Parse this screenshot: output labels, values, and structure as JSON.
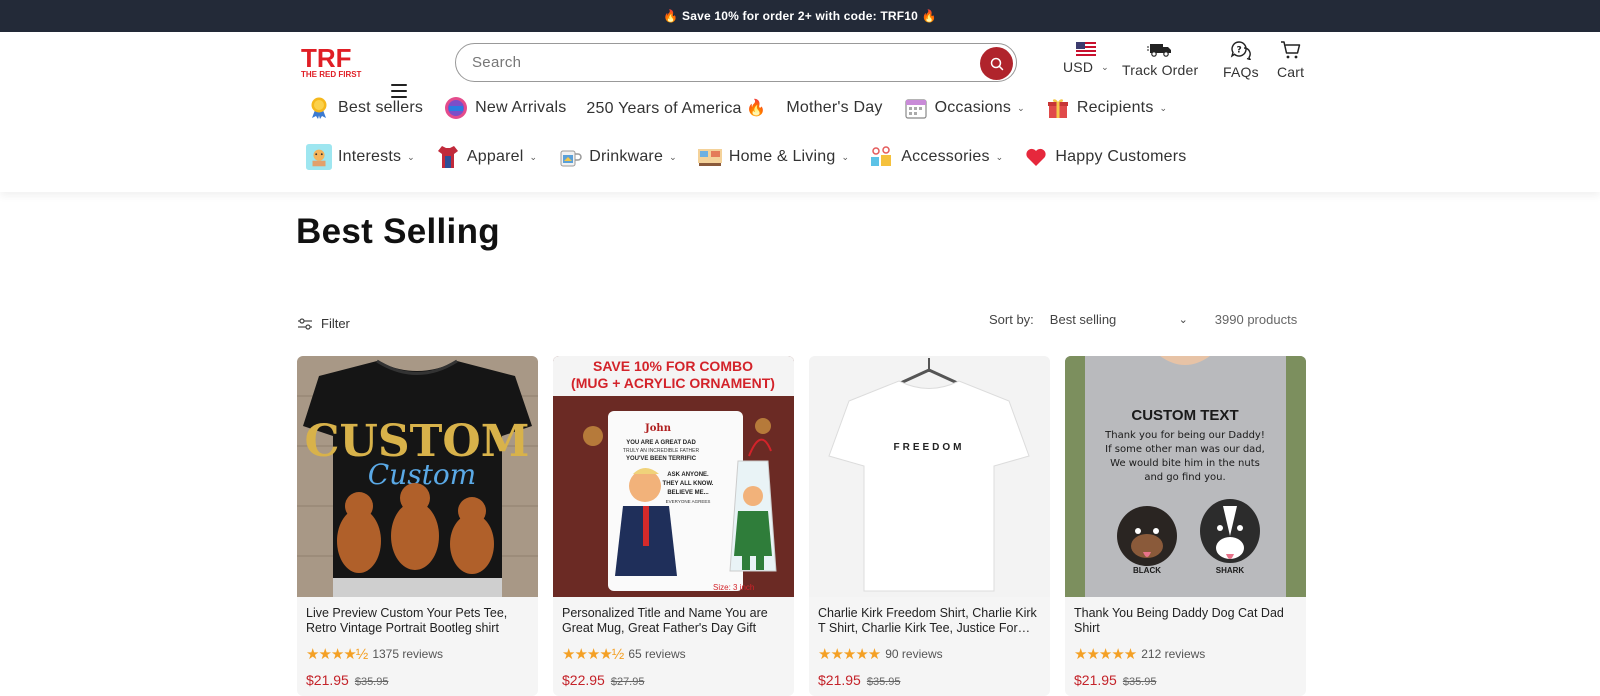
{
  "announcement": "🔥 Save 10% for order 2+ with code: TRF10 🔥",
  "header": {
    "logo_text": "TRF",
    "logo_subtext": "THE RED FIRST",
    "search_placeholder": "Search",
    "currency": "USD",
    "track_order": "Track Order",
    "faqs": "FAQs",
    "cart": "Cart"
  },
  "nav_row1": [
    {
      "label": "Best sellers"
    },
    {
      "label": "New Arrivals"
    },
    {
      "label": "250 Years of America 🔥"
    },
    {
      "label": "Mother's Day"
    },
    {
      "label": "Occasions"
    },
    {
      "label": "Recipients"
    }
  ],
  "nav_row2": [
    {
      "label": "Interests"
    },
    {
      "label": "Apparel"
    },
    {
      "label": "Drinkware"
    },
    {
      "label": "Home & Living"
    },
    {
      "label": "Accessories"
    },
    {
      "label": "Happy Customers"
    }
  ],
  "page_title": "Best Selling",
  "filter_label": "Filter",
  "sort": {
    "label": "Sort by:",
    "value": "Best selling",
    "count": "3990 products"
  },
  "products": [
    {
      "title": "Live Preview Custom Your Pets Tee, Retro Vintage Portrait Bootleg shirt",
      "stars": "★★★★½",
      "reviews": "1375 reviews",
      "price": "$21.95",
      "compare": "$35.95",
      "img_text_1": "CUSTOM",
      "img_text_2": "Custom"
    },
    {
      "title": "Personalized Title and Name You are Great Mug, Great Father's Day Gift",
      "stars": "★★★★½",
      "reviews": "65 reviews",
      "price": "$22.95",
      "compare": "$27.95",
      "img_text_1": "SAVE 10% FOR COMBO",
      "img_text_2": "(MUG + ACRYLIC ORNAMENT)",
      "mug_name": "John",
      "mug_line1": "YOU ARE A GREAT DAD",
      "mug_line2": "TRULY AN INCREDIBLE FATHER",
      "mug_line3": "YOU'VE BEEN TERRIFIC",
      "mug_line4": "ASK ANYONE.",
      "mug_line5": "THEY ALL KNOW.",
      "mug_line6": "BELIEVE ME...",
      "mug_line7": "EVERYONE AGREES",
      "size_label": "Size: 3 inch"
    },
    {
      "title": "Charlie Kirk Freedom Shirt, Charlie Kirk T Shirt, Charlie Kirk Tee, Justice For Charlie",
      "stars": "★★★★★",
      "reviews": "90 reviews",
      "price": "$21.95",
      "compare": "$35.95",
      "img_text_1": "FREEDOM"
    },
    {
      "title": "Thank You Being Daddy Dog Cat Dad Shirt",
      "stars": "★★★★★",
      "reviews": "212 reviews",
      "price": "$21.95",
      "compare": "$35.95",
      "img_text_1": "CUSTOM TEXT",
      "img_text_2": "Thank you for being our Daddy!",
      "img_text_3": "If some other man was our dad,",
      "img_text_4": "We would bite him in the nuts",
      "img_text_5": "and go find you.",
      "dog1": "BLACK",
      "dog2": "SHARK"
    }
  ],
  "colors": {
    "announce_bg": "#232a38",
    "accent": "#b0242c",
    "price": "#c4232a",
    "star": "#f4a025"
  }
}
